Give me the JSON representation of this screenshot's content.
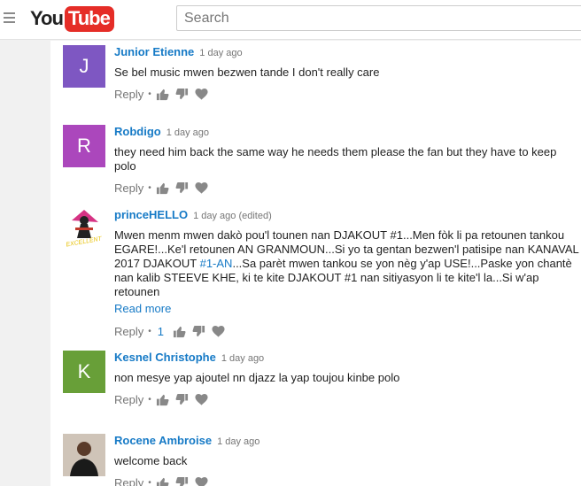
{
  "header": {
    "logo_you": "You",
    "logo_tube": "Tube",
    "search_placeholder": "Search"
  },
  "comments": [
    {
      "author": "Junior Etienne",
      "time": "1 day ago",
      "avatar_letter": "J",
      "avatar_color": "#7e57c2",
      "text": "Se bel music mwen bezwen tande I don't really care",
      "reply_label": "Reply"
    },
    {
      "author": "Robdigo",
      "time": "1 day ago",
      "avatar_letter": "R",
      "avatar_color": "#ab47bc",
      "text": "they need him back the same way he needs them please the fan but they have to keep polo",
      "reply_label": "Reply"
    },
    {
      "author": "princeHELLO",
      "time": "1 day ago (edited)",
      "avatar_text": "EXCELLENT",
      "text_part1": "Mwen menm mwen dakò pou'l tounen nan DJAKOUT #1...Men fòk li pa retounen tankou EGARE!...Ke'l retounen AN GRANMOUN...Si yo ta gentan bezwen'l patisipe nan KANAVAL 2017 DJAKOUT ",
      "hashtag": "#1-AN",
      "text_part2": "...Sa parèt mwen tankou se yon nèg y'ap USE!...Paske yon chantè nan kalib STEEVE KHE,  ki te kite DJAKOUT #1 nan sitiyasyon li te kite'l la...Si w'ap retounen",
      "read_more": "Read more",
      "reply_label": "Reply",
      "likes": "1"
    },
    {
      "author": "Kesnel Christophe",
      "time": "1 day ago",
      "avatar_letter": "K",
      "avatar_color": "#689f38",
      "text": "non mesye yap ajoutel nn djazz la yap toujou kinbe polo",
      "reply_label": "Reply"
    },
    {
      "author": "Rocene Ambroise",
      "time": "1 day ago",
      "text": "welcome back",
      "reply_label": "Reply"
    }
  ]
}
